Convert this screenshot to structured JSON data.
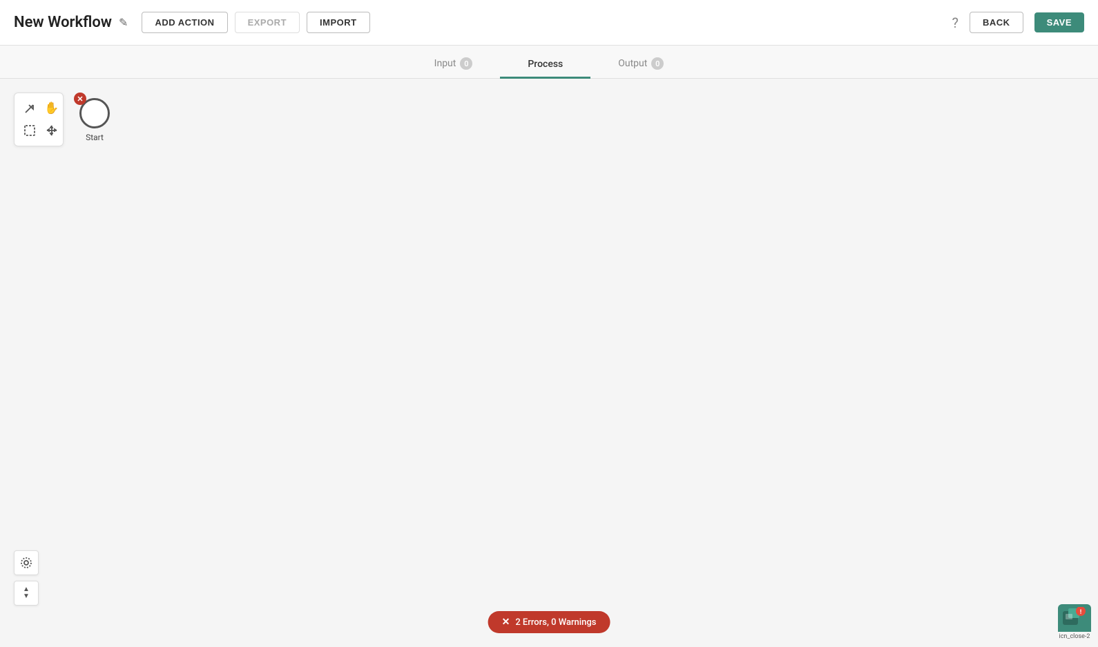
{
  "header": {
    "title": "New Workflow",
    "edit_icon": "✎",
    "buttons": {
      "add_action": "ADD ACTION",
      "export": "EXPORT",
      "import": "IMPORT",
      "back": "BACK",
      "save": "SAVE"
    }
  },
  "tabs": [
    {
      "id": "input",
      "label": "Input",
      "badge": "0",
      "active": false
    },
    {
      "id": "process",
      "label": "Process",
      "badge": null,
      "active": true
    },
    {
      "id": "output",
      "label": "Output",
      "badge": "0",
      "active": false
    }
  ],
  "toolbar": {
    "tools": [
      {
        "id": "arrow",
        "icon": "↗",
        "label": "arrow-tool"
      },
      {
        "id": "hand",
        "icon": "✋",
        "label": "hand-tool"
      },
      {
        "id": "select",
        "icon": "⬚",
        "label": "select-tool"
      },
      {
        "id": "move",
        "icon": "⊕",
        "label": "move-tool"
      }
    ]
  },
  "canvas": {
    "start_node": {
      "label": "Start",
      "delete_icon": "✕"
    }
  },
  "controls": {
    "center_icon": "◎",
    "zoom_up": "▲",
    "zoom_down": "▼"
  },
  "error_bar": {
    "icon": "✕",
    "text": "2 Errors, 0 Warnings"
  },
  "logo": {
    "label": "icn_close-2"
  },
  "colors": {
    "primary": "#3d8b7a",
    "error": "#c0392b",
    "border": "#ddd"
  }
}
